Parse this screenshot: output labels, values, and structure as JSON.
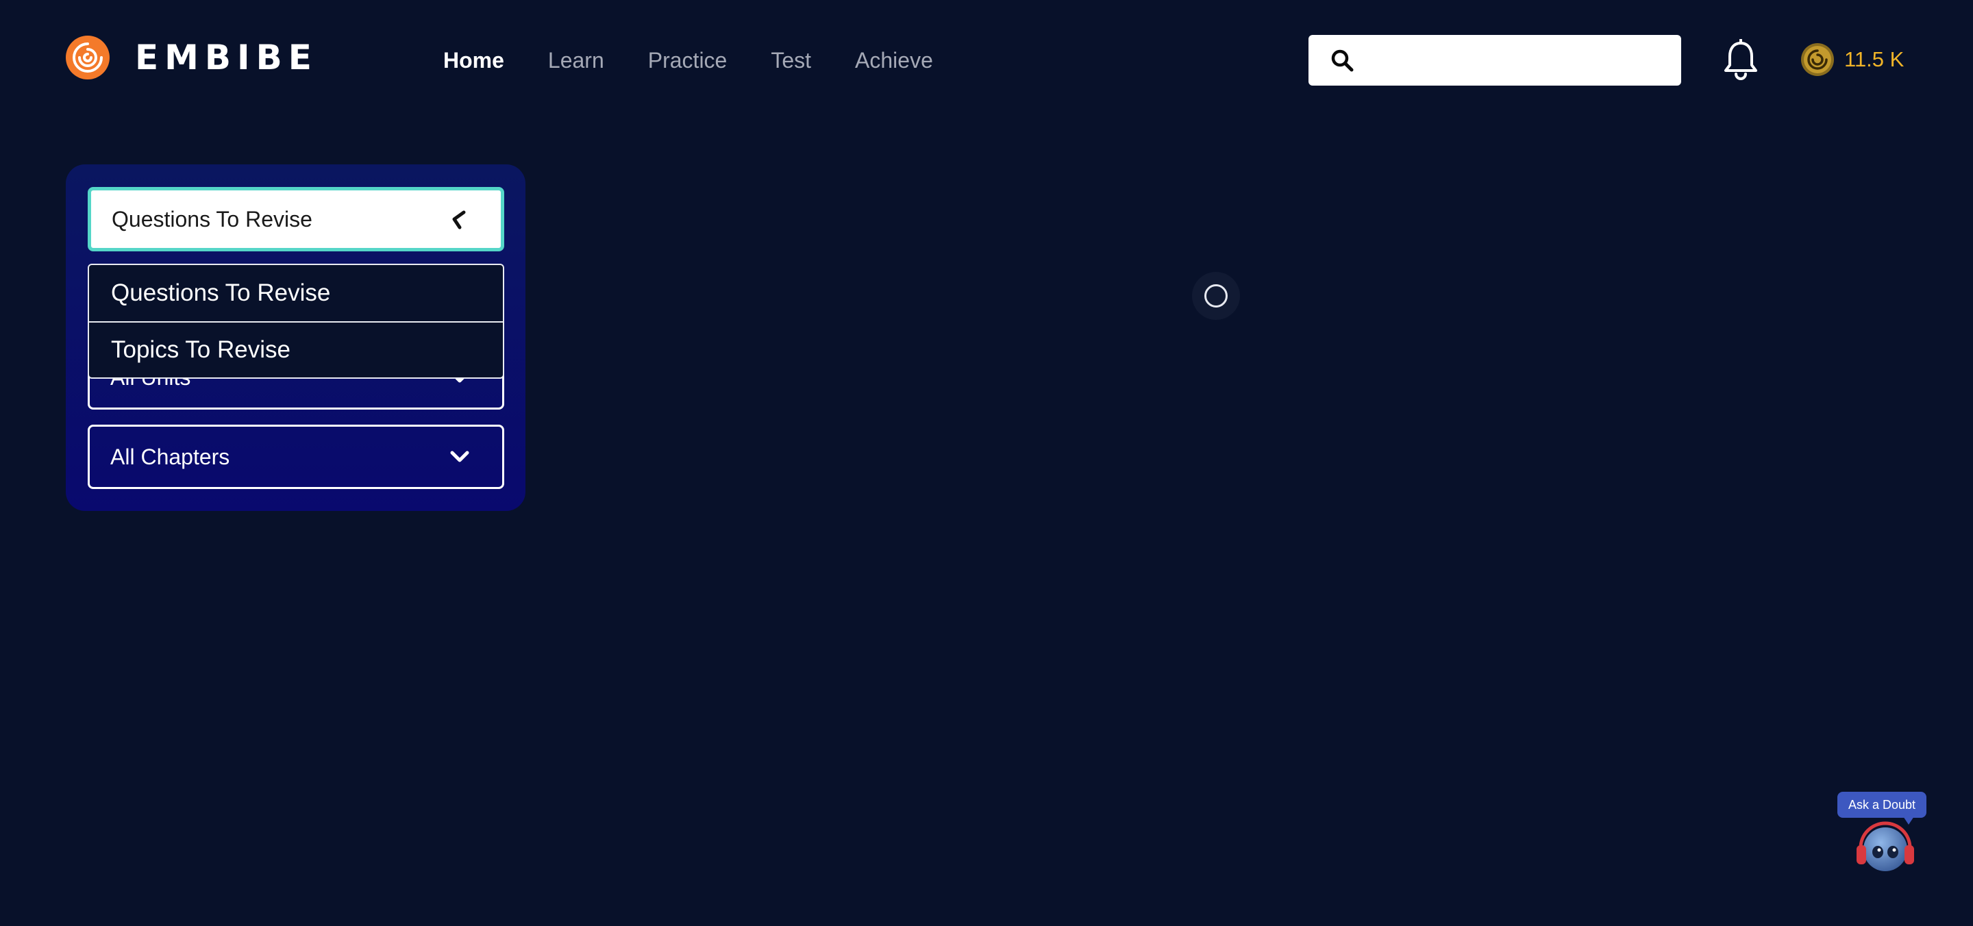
{
  "brand": {
    "name": "EMBIBE",
    "logo_icon": "embibe-swirl-icon",
    "color": "#f47a2a"
  },
  "nav": {
    "items": [
      {
        "label": "Home",
        "active": true
      },
      {
        "label": "Learn",
        "active": false
      },
      {
        "label": "Practice",
        "active": false
      },
      {
        "label": "Test",
        "active": false
      },
      {
        "label": "Achieve",
        "active": false
      }
    ]
  },
  "search": {
    "placeholder": "",
    "value": ""
  },
  "notifications": {
    "icon": "bell-icon"
  },
  "coins": {
    "value": "11.5 K",
    "icon": "embibe-coin-icon",
    "color": "#f0b428"
  },
  "filters": {
    "primary": {
      "selected": "Questions To Revise",
      "open": true,
      "icon": "chevron-left-icon"
    },
    "options": [
      "Questions To Revise",
      "Topics To Revise"
    ],
    "units": {
      "selected": "All Units",
      "icon": "chevron-down-icon"
    },
    "chapters": {
      "selected": "All Chapters",
      "icon": "chevron-down-icon"
    }
  },
  "loading": {
    "icon": "loading-spinner-icon"
  },
  "ask_doubt": {
    "label": "Ask a Doubt",
    "icon": "robot-avatar-icon"
  },
  "colors": {
    "background": "#08112a",
    "panel": "#0a1660",
    "focus_border": "#55d6c8"
  }
}
